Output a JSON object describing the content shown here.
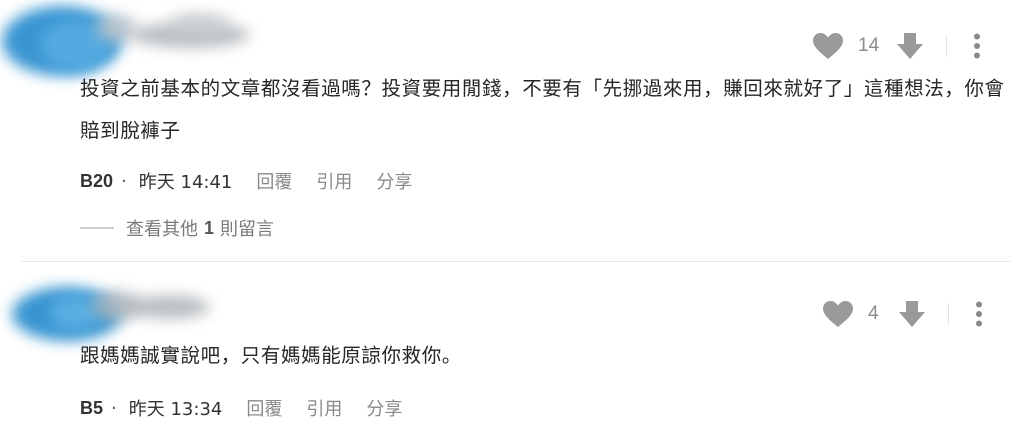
{
  "comments": [
    {
      "likes": "14",
      "text": "投資之前基本的文章都沒看過嗎？投資要用閒錢，不要有「先挪過來用，賺回來就好了」這種想法，你會賠到脫褲子",
      "floor": "B20",
      "separator": "·",
      "time": "昨天 14:41",
      "reply_label": "回覆",
      "quote_label": "引用",
      "share_label": "分享",
      "view_more": {
        "prefix": "查看其他",
        "count": "1",
        "suffix": "則留言"
      }
    },
    {
      "likes": "4",
      "text": "跟媽媽誠實說吧，只有媽媽能原諒你救你。",
      "floor": "B5",
      "separator": "·",
      "time": "昨天 13:34",
      "reply_label": "回覆",
      "quote_label": "引用",
      "share_label": "分享"
    }
  ],
  "icons": {
    "like": "heart-icon",
    "dislike": "arrow-down-icon",
    "more": "more-vertical-icon"
  },
  "colors": {
    "icon_gray": "#9a9a9a",
    "avatar_blue": "#2f8fcf",
    "divider": "#e6e6e6"
  }
}
